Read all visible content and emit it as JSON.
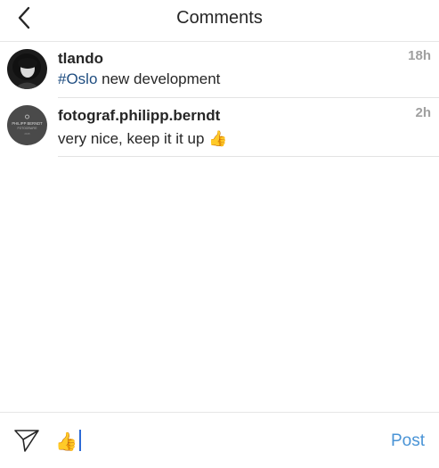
{
  "header": {
    "title": "Comments",
    "back_icon": "chevron-left-icon"
  },
  "comments": [
    {
      "username": "tlando",
      "hashtag": "#Oslo",
      "text": " new development",
      "time": "18h",
      "avatar_icon": "portrait-avatar"
    },
    {
      "username": "fotograf.philipp.berndt",
      "text": "very nice, keep it it up 👍",
      "time": "2h",
      "avatar_icon": "logo-avatar",
      "avatar_logo_line1": "PHILIPP BERNDT",
      "avatar_logo_line2": "FOTOGRAFIE",
      "avatar_logo_line3": "2015"
    }
  ],
  "composer": {
    "value": "👍",
    "send_icon": "send-icon",
    "post_label": "Post"
  },
  "colors": {
    "hashtag": "#1f4d80",
    "post": "#4a94d6",
    "time": "#a0a0a0"
  }
}
